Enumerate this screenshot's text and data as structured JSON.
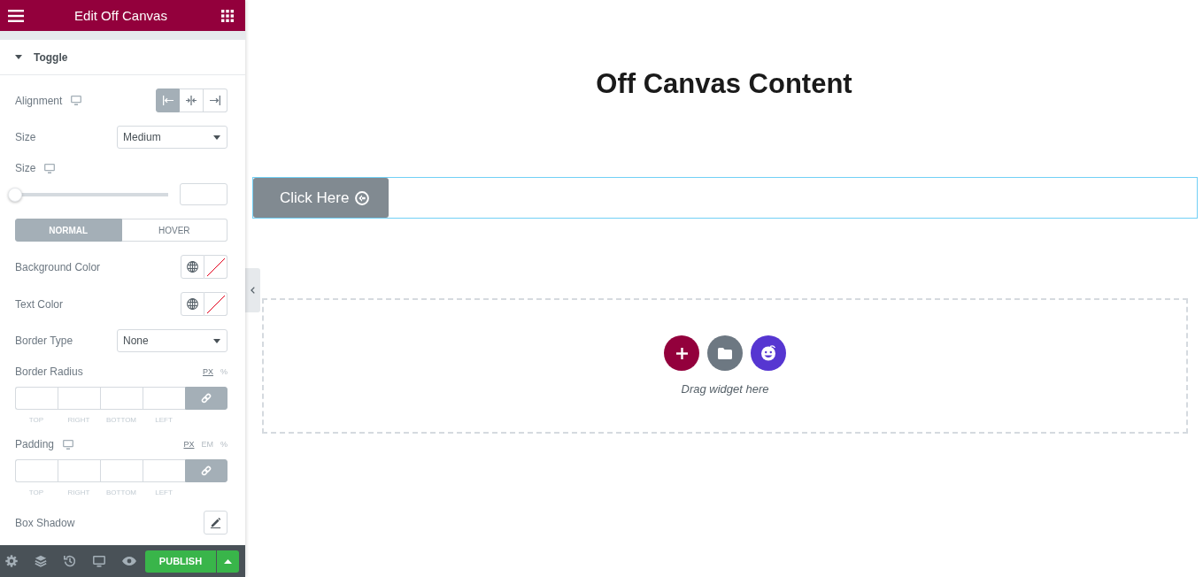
{
  "header": {
    "title": "Edit Off Canvas"
  },
  "section": {
    "title": "Toggle",
    "expanded": true,
    "controls": [
      {
        "kind": "choose",
        "label": "Alignment",
        "responsive": true,
        "options": [
          {
            "kind": "left",
            "selected": true
          },
          {
            "kind": "center",
            "selected": false
          },
          {
            "kind": "right",
            "selected": false
          }
        ]
      },
      {
        "kind": "select",
        "label": "Size",
        "responsive": false,
        "value": "Medium"
      },
      {
        "kind": "slider",
        "label": "Size",
        "responsive": true,
        "level": 0
      },
      {
        "kind": "tabs",
        "tabs": [
          {
            "label": "NORMAL",
            "selected": true
          },
          {
            "label": "HOVER",
            "selected": false
          }
        ]
      },
      {
        "kind": "color",
        "label": "Background Color",
        "responsive": false
      },
      {
        "kind": "color",
        "label": "Text Color",
        "responsive": false
      },
      {
        "kind": "select",
        "label": "Border Type",
        "responsive": false,
        "value": "None"
      },
      {
        "kind": "dimensions",
        "label": "Border Radius",
        "responsive": false,
        "units": [
          {
            "label": "PX",
            "selected": true
          },
          {
            "label": "%",
            "selected": false
          }
        ],
        "sides": [
          "TOP",
          "RIGHT",
          "BOTTOM",
          "LEFT"
        ],
        "linked": true
      },
      {
        "kind": "dimensions",
        "label": "Padding",
        "responsive": true,
        "units": [
          {
            "label": "PX",
            "selected": true
          },
          {
            "label": "EM",
            "selected": false
          },
          {
            "label": "%",
            "selected": false
          }
        ],
        "sides": [
          "TOP",
          "RIGHT",
          "BOTTOM",
          "LEFT"
        ],
        "linked": true
      },
      {
        "kind": "popover",
        "label": "Box Shadow",
        "responsive": false
      }
    ]
  },
  "footer": {
    "publish": "PUBLISH"
  },
  "canvas": {
    "heading": "Off Canvas Content",
    "section": {
      "selected": true,
      "button": {
        "label": "Click Here"
      }
    },
    "drop_zone": {
      "hint": "Drag widget here"
    }
  }
}
